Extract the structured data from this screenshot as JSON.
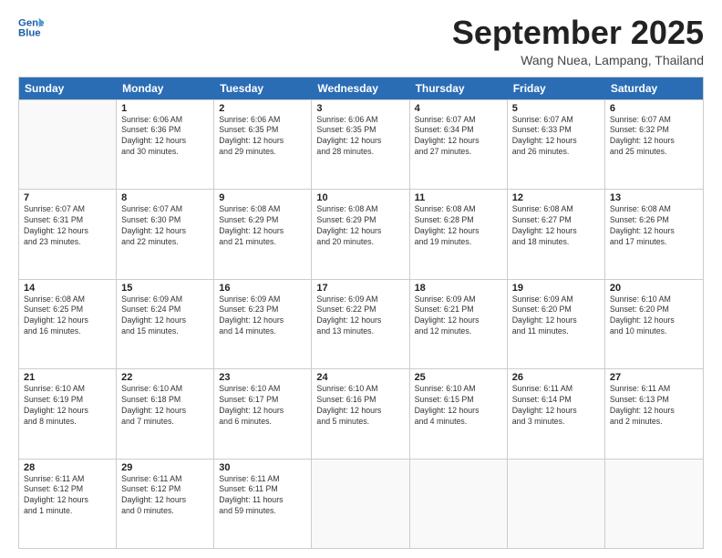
{
  "logo": {
    "line1": "General",
    "line2": "Blue"
  },
  "title": "September 2025",
  "location": "Wang Nuea, Lampang, Thailand",
  "header_days": [
    "Sunday",
    "Monday",
    "Tuesday",
    "Wednesday",
    "Thursday",
    "Friday",
    "Saturday"
  ],
  "rows": [
    [
      {
        "date": "",
        "info": ""
      },
      {
        "date": "1",
        "info": "Sunrise: 6:06 AM\nSunset: 6:36 PM\nDaylight: 12 hours\nand 30 minutes."
      },
      {
        "date": "2",
        "info": "Sunrise: 6:06 AM\nSunset: 6:35 PM\nDaylight: 12 hours\nand 29 minutes."
      },
      {
        "date": "3",
        "info": "Sunrise: 6:06 AM\nSunset: 6:35 PM\nDaylight: 12 hours\nand 28 minutes."
      },
      {
        "date": "4",
        "info": "Sunrise: 6:07 AM\nSunset: 6:34 PM\nDaylight: 12 hours\nand 27 minutes."
      },
      {
        "date": "5",
        "info": "Sunrise: 6:07 AM\nSunset: 6:33 PM\nDaylight: 12 hours\nand 26 minutes."
      },
      {
        "date": "6",
        "info": "Sunrise: 6:07 AM\nSunset: 6:32 PM\nDaylight: 12 hours\nand 25 minutes."
      }
    ],
    [
      {
        "date": "7",
        "info": "Sunrise: 6:07 AM\nSunset: 6:31 PM\nDaylight: 12 hours\nand 23 minutes."
      },
      {
        "date": "8",
        "info": "Sunrise: 6:07 AM\nSunset: 6:30 PM\nDaylight: 12 hours\nand 22 minutes."
      },
      {
        "date": "9",
        "info": "Sunrise: 6:08 AM\nSunset: 6:29 PM\nDaylight: 12 hours\nand 21 minutes."
      },
      {
        "date": "10",
        "info": "Sunrise: 6:08 AM\nSunset: 6:29 PM\nDaylight: 12 hours\nand 20 minutes."
      },
      {
        "date": "11",
        "info": "Sunrise: 6:08 AM\nSunset: 6:28 PM\nDaylight: 12 hours\nand 19 minutes."
      },
      {
        "date": "12",
        "info": "Sunrise: 6:08 AM\nSunset: 6:27 PM\nDaylight: 12 hours\nand 18 minutes."
      },
      {
        "date": "13",
        "info": "Sunrise: 6:08 AM\nSunset: 6:26 PM\nDaylight: 12 hours\nand 17 minutes."
      }
    ],
    [
      {
        "date": "14",
        "info": "Sunrise: 6:08 AM\nSunset: 6:25 PM\nDaylight: 12 hours\nand 16 minutes."
      },
      {
        "date": "15",
        "info": "Sunrise: 6:09 AM\nSunset: 6:24 PM\nDaylight: 12 hours\nand 15 minutes."
      },
      {
        "date": "16",
        "info": "Sunrise: 6:09 AM\nSunset: 6:23 PM\nDaylight: 12 hours\nand 14 minutes."
      },
      {
        "date": "17",
        "info": "Sunrise: 6:09 AM\nSunset: 6:22 PM\nDaylight: 12 hours\nand 13 minutes."
      },
      {
        "date": "18",
        "info": "Sunrise: 6:09 AM\nSunset: 6:21 PM\nDaylight: 12 hours\nand 12 minutes."
      },
      {
        "date": "19",
        "info": "Sunrise: 6:09 AM\nSunset: 6:20 PM\nDaylight: 12 hours\nand 11 minutes."
      },
      {
        "date": "20",
        "info": "Sunrise: 6:10 AM\nSunset: 6:20 PM\nDaylight: 12 hours\nand 10 minutes."
      }
    ],
    [
      {
        "date": "21",
        "info": "Sunrise: 6:10 AM\nSunset: 6:19 PM\nDaylight: 12 hours\nand 8 minutes."
      },
      {
        "date": "22",
        "info": "Sunrise: 6:10 AM\nSunset: 6:18 PM\nDaylight: 12 hours\nand 7 minutes."
      },
      {
        "date": "23",
        "info": "Sunrise: 6:10 AM\nSunset: 6:17 PM\nDaylight: 12 hours\nand 6 minutes."
      },
      {
        "date": "24",
        "info": "Sunrise: 6:10 AM\nSunset: 6:16 PM\nDaylight: 12 hours\nand 5 minutes."
      },
      {
        "date": "25",
        "info": "Sunrise: 6:10 AM\nSunset: 6:15 PM\nDaylight: 12 hours\nand 4 minutes."
      },
      {
        "date": "26",
        "info": "Sunrise: 6:11 AM\nSunset: 6:14 PM\nDaylight: 12 hours\nand 3 minutes."
      },
      {
        "date": "27",
        "info": "Sunrise: 6:11 AM\nSunset: 6:13 PM\nDaylight: 12 hours\nand 2 minutes."
      }
    ],
    [
      {
        "date": "28",
        "info": "Sunrise: 6:11 AM\nSunset: 6:12 PM\nDaylight: 12 hours\nand 1 minute."
      },
      {
        "date": "29",
        "info": "Sunrise: 6:11 AM\nSunset: 6:12 PM\nDaylight: 12 hours\nand 0 minutes."
      },
      {
        "date": "30",
        "info": "Sunrise: 6:11 AM\nSunset: 6:11 PM\nDaylight: 11 hours\nand 59 minutes."
      },
      {
        "date": "",
        "info": ""
      },
      {
        "date": "",
        "info": ""
      },
      {
        "date": "",
        "info": ""
      },
      {
        "date": "",
        "info": ""
      }
    ]
  ]
}
